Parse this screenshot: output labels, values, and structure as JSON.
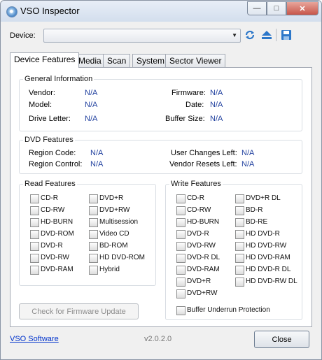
{
  "window": {
    "title": "VSO Inspector",
    "min_glyph": "—",
    "max_glyph": "□",
    "close_glyph": "✕"
  },
  "device": {
    "label": "Device:",
    "selected": ""
  },
  "tabs": [
    "Device Features",
    "Media",
    "Scan",
    "System",
    "Sector Viewer"
  ],
  "general": {
    "title": "General Information",
    "vendor_label": "Vendor:",
    "vendor": "N/A",
    "model_label": "Model:",
    "model": "N/A",
    "drive_letter_label": "Drive Letter:",
    "drive_letter": "N/A",
    "firmware_label": "Firmware:",
    "firmware": "N/A",
    "date_label": "Date:",
    "date": "N/A",
    "buffer_label": "Buffer Size:",
    "buffer": "N/A"
  },
  "dvd": {
    "title": "DVD Features",
    "region_code_label": "Region Code:",
    "region_code": "N/A",
    "region_control_label": "Region Control:",
    "region_control": "N/A",
    "user_changes_label": "User Changes Left:",
    "user_changes": "N/A",
    "vendor_resets_label": "Vendor Resets Left:",
    "vendor_resets": "N/A"
  },
  "read": {
    "title": "Read Features",
    "col1": [
      "CD-R",
      "CD-RW",
      "HD-BURN",
      "DVD-ROM",
      "DVD-R",
      "DVD-RW",
      "DVD-RAM"
    ],
    "col2": [
      "DVD+R",
      "DVD+RW",
      "Multisession",
      "Video CD",
      "BD-ROM",
      "HD DVD-ROM",
      "Hybrid"
    ]
  },
  "write": {
    "title": "Write Features",
    "col1": [
      "CD-R",
      "CD-RW",
      "HD-BURN",
      "DVD-R",
      "DVD-RW",
      "DVD-R DL",
      "DVD-RAM",
      "DVD+R",
      "DVD+RW"
    ],
    "col2": [
      "DVD+R DL",
      "BD-R",
      "BD-RE",
      "HD DVD-R",
      "HD DVD-RW",
      "HD DVD-RAM",
      "HD DVD-R DL",
      "HD DVD-RW DL"
    ],
    "buffer_underrun": "Buffer Underrun Protection"
  },
  "firmware_button": "Check for Firmware Update",
  "footer": {
    "link": "VSO Software",
    "version": "v2.0.2.0",
    "close": "Close"
  }
}
